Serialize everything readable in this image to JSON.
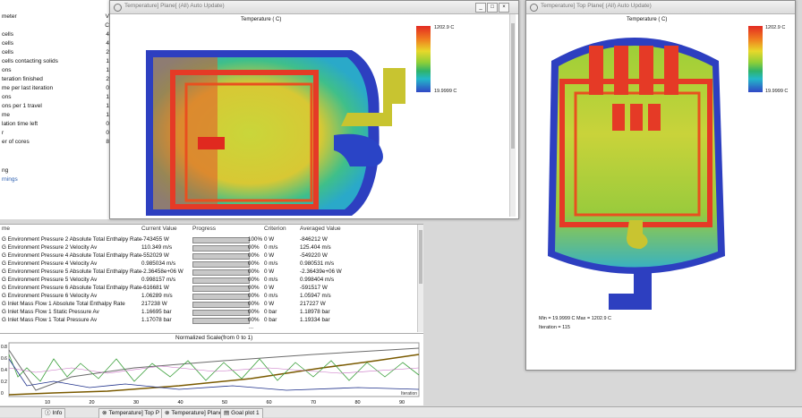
{
  "left_panel": {
    "rows": [
      {
        "label": "meter",
        "value": "V"
      },
      {
        "label": "",
        "value": "C"
      },
      {
        "label": "cells",
        "value": "4"
      },
      {
        "label": "cells",
        "value": "4"
      },
      {
        "label": "cells",
        "value": "2"
      },
      {
        "label": "cells contacting solids",
        "value": "1"
      },
      {
        "label": "ons",
        "value": "1"
      },
      {
        "label": "teration finished",
        "value": "2"
      },
      {
        "label": "me per last iteration",
        "value": "0"
      },
      {
        "label": "ons",
        "value": "1"
      },
      {
        "label": "ons per 1 travel",
        "value": "1"
      },
      {
        "label": "me",
        "value": "1"
      },
      {
        "label": "lation time left",
        "value": "0"
      },
      {
        "label": "r",
        "value": "0"
      },
      {
        "label": "er of cores",
        "value": "8"
      }
    ],
    "section1": "ng",
    "section2": "rnings"
  },
  "window1": {
    "title": "Temperature] Plane[ (All) Auto Update)",
    "plot_title": "Temperature ( C)",
    "legend_max": "1202.9 C",
    "legend_min": "19.9999 C"
  },
  "window2": {
    "title": "Temperature] Top Plane[ (All) Auto Update)",
    "plot_title": "Temperature ( C)",
    "legend_max": "1202.9 C",
    "legend_min": "19.9999 C",
    "minmax": "Min = 19.9999 C   Max = 1202.9 C",
    "iteration": "Iteration = 115"
  },
  "goals_table": {
    "headers": [
      "me",
      "Current Value",
      "Progress",
      "Criterion",
      "Averaged Value"
    ],
    "rows": [
      {
        "name": "G Environment Pressure 2 Absolute Total Enthalpy Rate",
        "current": "-743455 W",
        "progress": "100%",
        "criterion": "0 W",
        "averaged": "-846212 W",
        "fill": 1.0
      },
      {
        "name": "G Environment Pressure 2 Velocity Av",
        "current": "110.349 m/s",
        "progress": "00%",
        "criterion": "0 m/s",
        "averaged": "125.404 m/s",
        "fill": 1.0
      },
      {
        "name": "G Environment Pressure 4 Absolute Total Enthalpy Rate",
        "current": "-552029 W",
        "progress": "00%",
        "criterion": "0 W",
        "averaged": "-549220 W",
        "fill": 1.0
      },
      {
        "name": "G Environment Pressure 4 Velocity Av",
        "current": "0.985034 m/s",
        "progress": "00%",
        "criterion": "0 m/s",
        "averaged": "0.980531 m/s",
        "fill": 1.0
      },
      {
        "name": "G Environment Pressure 5 Absolute Total Enthalpy Rate",
        "current": "-2.36458e+06 W",
        "progress": "00%",
        "criterion": "0 W",
        "averaged": "-2.36439e+06 W",
        "fill": 1.0
      },
      {
        "name": "G Environment Pressure 5 Velocity Av",
        "current": "0.998157 m/s",
        "progress": "00%",
        "criterion": "0 m/s",
        "averaged": "0.998404 m/s",
        "fill": 1.0
      },
      {
        "name": "G Environment Pressure 6 Absolute Total Enthalpy Rate",
        "current": "-616681 W",
        "progress": "00%",
        "criterion": "0 W",
        "averaged": "-591517 W",
        "fill": 1.0
      },
      {
        "name": "G Environment Pressure 6 Velocity Av",
        "current": "1.06289 m/s",
        "progress": "00%",
        "criterion": "0 m/s",
        "averaged": "1.05947 m/s",
        "fill": 1.0
      },
      {
        "name": "G Inlet Mass Flow 1 Absolute Total Enthalpy Rate",
        "current": "217238 W",
        "progress": "00%",
        "criterion": "0 W",
        "averaged": "217227 W",
        "fill": 1.0
      },
      {
        "name": "G Inlet Mass Flow 1 Static Pressure Av",
        "current": "1.16695 bar",
        "progress": "00%",
        "criterion": "0 bar",
        "averaged": "1.18978 bar",
        "fill": 1.0
      },
      {
        "name": "G Inlet Mass Flow 1 Total Pressure Av",
        "current": "1.17078 bar",
        "progress": "00%",
        "criterion": "0 bar",
        "averaged": "1.19334 bar",
        "fill": 1.0
      }
    ],
    "ellipsis": "..."
  },
  "graph": {
    "title": "Normalized Scale(from 0 to 1)",
    "y_ticks": [
      "0.8",
      "0.6",
      "0.4",
      "0.2",
      "0"
    ],
    "x_ticks": [
      "10",
      "20",
      "30",
      "40",
      "50",
      "60",
      "70",
      "80",
      "90"
    ],
    "x_label": "Iteration"
  },
  "tabs": [
    {
      "label": "Info",
      "icon": "info-icon"
    },
    {
      "label": "Temperature] Top P",
      "icon": "plot-icon"
    },
    {
      "label": "Temperature] Plane[",
      "icon": "plot-icon"
    },
    {
      "label": "Goal plot 1",
      "icon": "goal-plot-icon"
    }
  ]
}
